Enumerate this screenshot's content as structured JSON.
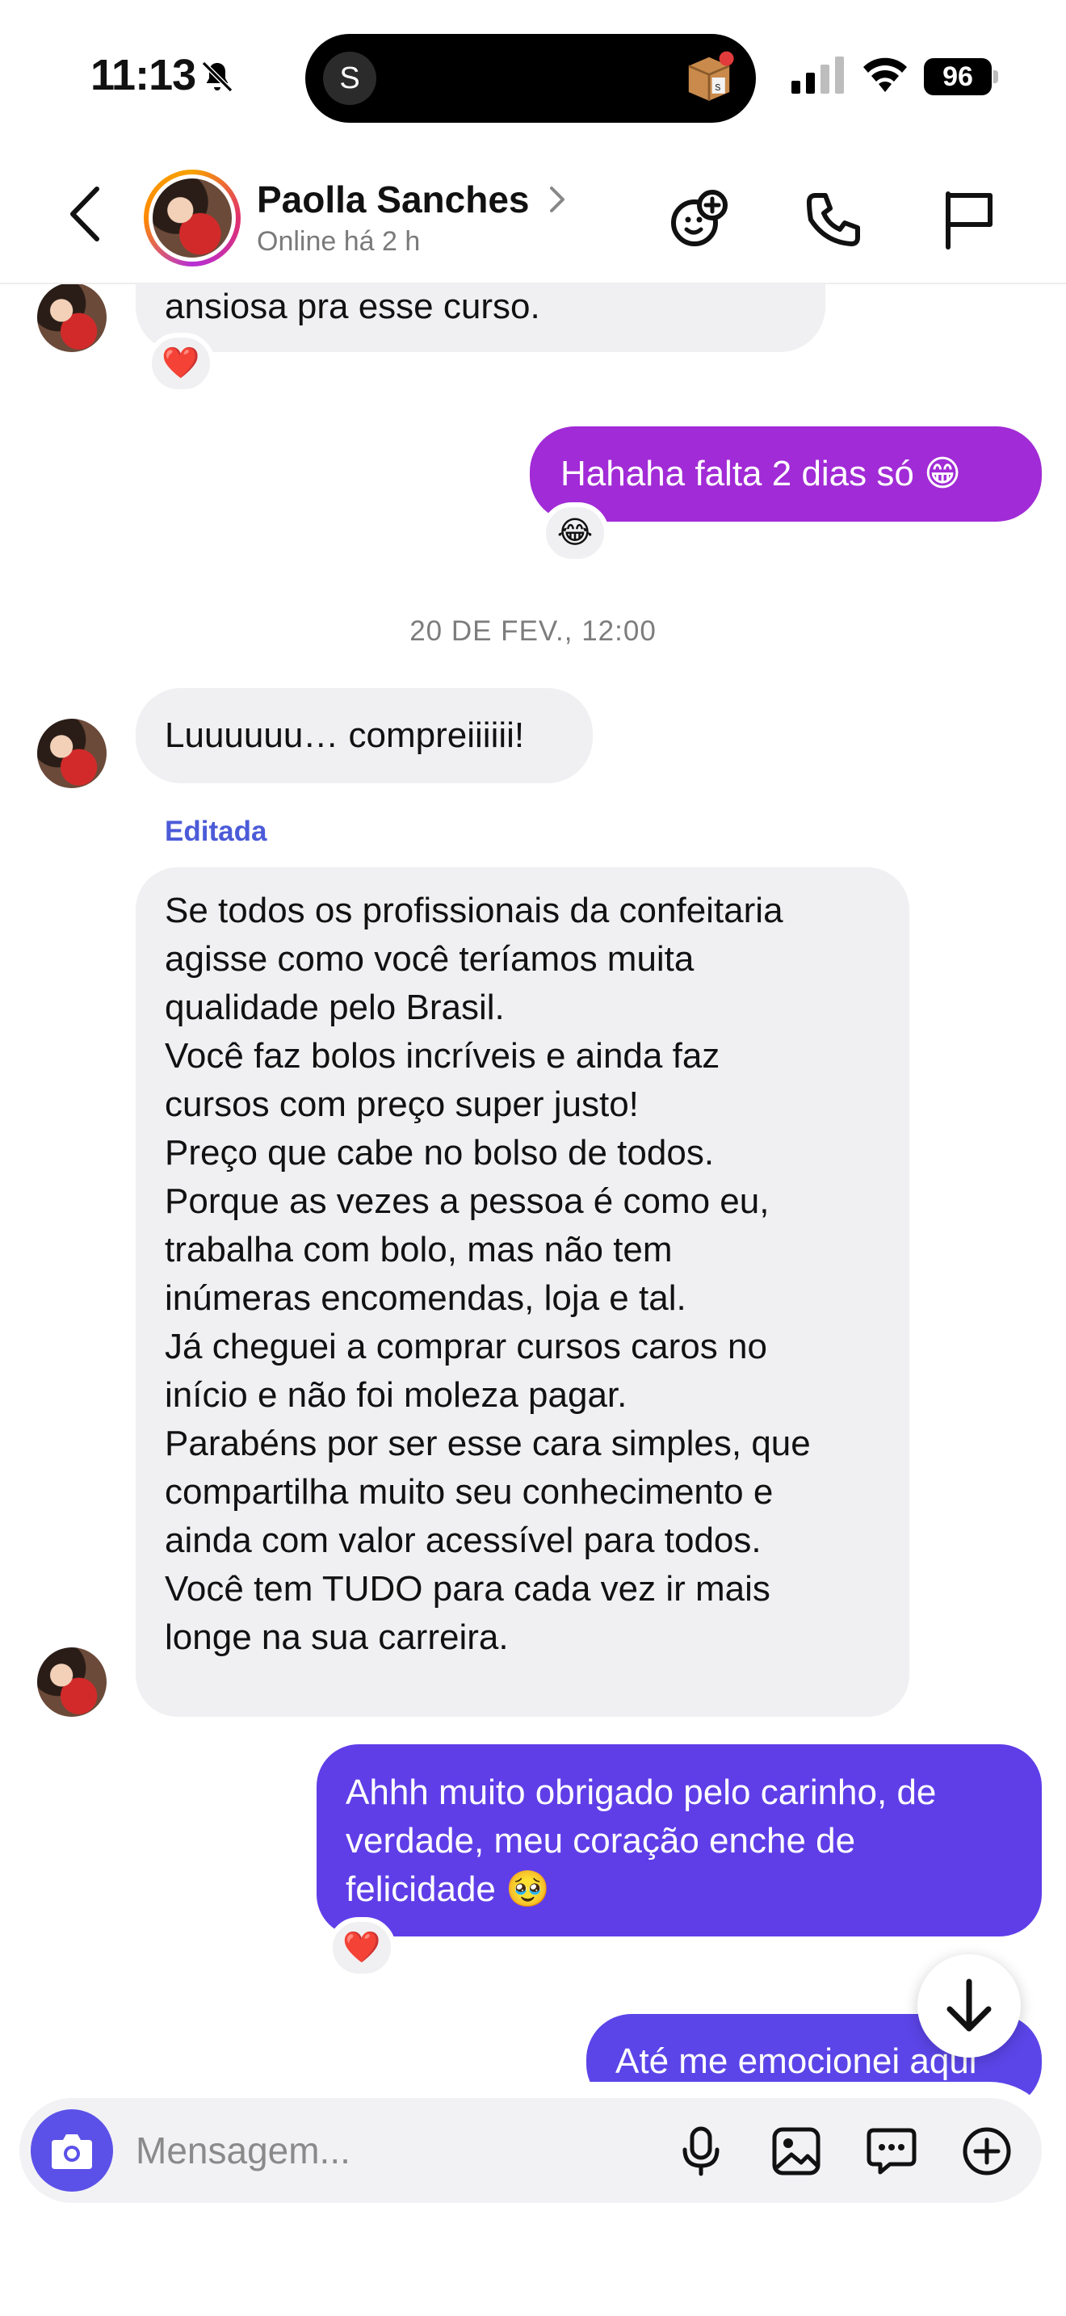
{
  "status_bar": {
    "time": "11:13",
    "island_badge": "S",
    "battery": "96"
  },
  "header": {
    "name": "Paolla Sanches",
    "status": "Online há 2 h"
  },
  "messages": {
    "m1": {
      "text": "ansiosa pra esse curso.",
      "reaction": "❤️"
    },
    "m2": {
      "text": "Hahaha falta 2 dias só 😁",
      "reaction": "😂"
    },
    "date_separator": "20 DE FEV., 12:00",
    "m3": {
      "text": "Luuuuuu… compreiiiiii!"
    },
    "edited_label": "Editada",
    "m4": {
      "lines": [
        "Se todos os profissionais da confeitaria",
        "agisse como você teríamos muita",
        "qualidade pelo Brasil.",
        "Você faz bolos incríveis e ainda faz",
        "cursos com preço super justo!",
        "Preço que cabe no bolso de todos.",
        "Porque as vezes a pessoa é como eu,",
        "trabalha com bolo, mas não tem",
        "inúmeras encomendas, loja e tal.",
        "Já cheguei a comprar cursos caros no",
        "início e não foi moleza pagar.",
        "Parabéns por ser esse cara simples, que",
        "compartilha muito seu conhecimento e",
        "ainda com valor acessível para todos.",
        "Você tem TUDO para cada vez ir mais",
        "longe na sua carreira."
      ]
    },
    "m5": {
      "lines": [
        "Ahhh muito obrigado pelo carinho, de",
        "verdade, meu coração enche de",
        "felicidade 🥹"
      ],
      "reaction": "❤️"
    },
    "m6": {
      "text": "Até me emocionei aqui"
    }
  },
  "composer": {
    "placeholder": "Mensagem..."
  },
  "colors": {
    "outgoing_top": "#a12bd6",
    "outgoing_bottom": "#5b45e8",
    "incoming": "#f0f0f2",
    "accent": "#5b51e8"
  }
}
